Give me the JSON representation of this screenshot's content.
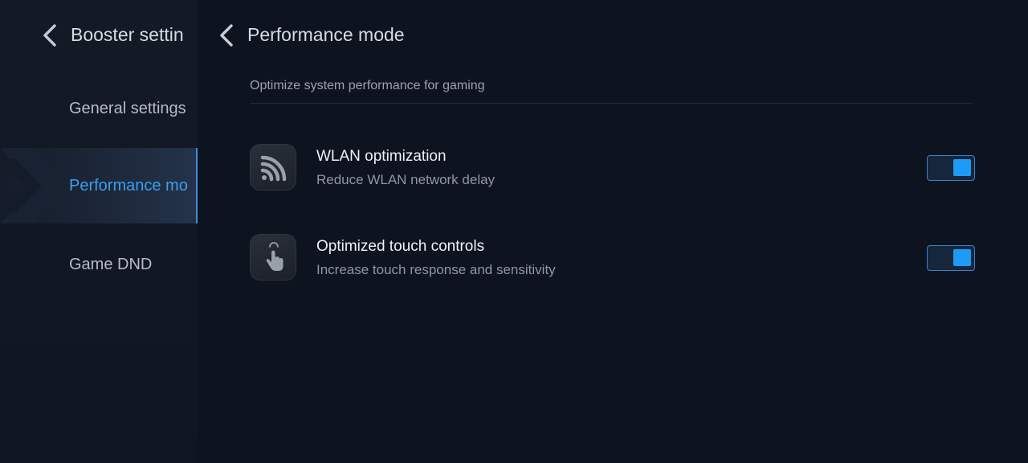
{
  "sidebar": {
    "title": "Booster settin",
    "items": [
      {
        "label": "General settings"
      },
      {
        "label": "Performance mo"
      },
      {
        "label": "Game DND"
      }
    ]
  },
  "main": {
    "title": "Performance mode",
    "subtitle": "Optimize system performance for gaming",
    "rows": [
      {
        "title": "WLAN optimization",
        "description": "Reduce WLAN network delay",
        "icon": "wlan-signal-icon",
        "enabled": true
      },
      {
        "title": "Optimized touch controls",
        "description": "Increase touch response and sensitivity",
        "icon": "touch-hand-icon",
        "enabled": true
      }
    ]
  },
  "colors": {
    "background": "#0d1420",
    "sidebar": "#131a26",
    "accent": "#3aa0f0",
    "toggle_on": "#1e9bf5"
  }
}
